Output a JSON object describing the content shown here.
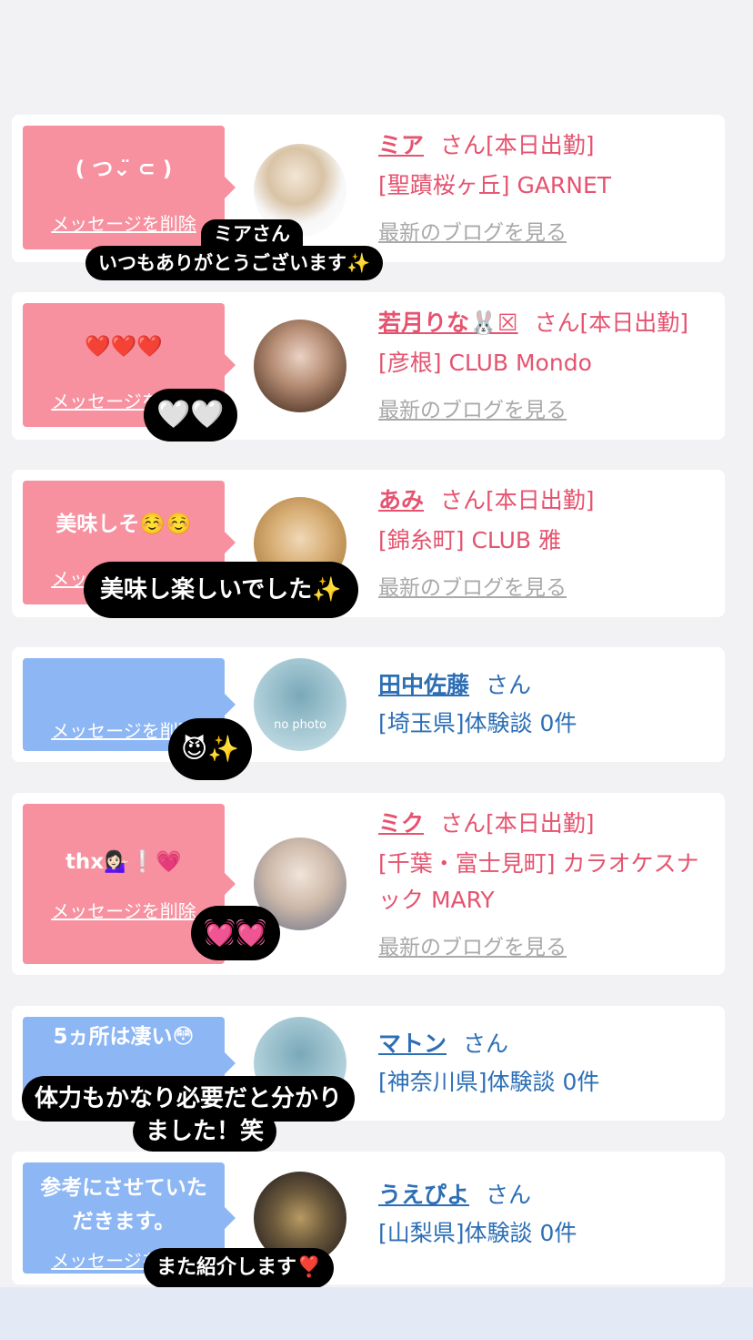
{
  "delete_label": "メッセージを削除",
  "blog_label": "最新のブログを見る",
  "cards": [
    {
      "message": "( つ⌄̈ ⊂ )",
      "name": "ミア",
      "suffix": "さん[本日出勤]",
      "shop": "[聖蹟桜ヶ丘] GARNET",
      "blog": "最新のブログを見る"
    },
    {
      "message": "❤️❤️❤️",
      "name": "若月りな🐰☒",
      "suffix": "さん[本日出勤]",
      "shop": "[彦根] CLUB Mondo",
      "blog": "最新のブログを見る"
    },
    {
      "message": "美味しそ☺️☺️",
      "name": "あみ",
      "suffix": "さん[本日出勤]",
      "shop": "[錦糸町] CLUB 雅",
      "blog": "最新のブログを見る"
    },
    {
      "message": "",
      "name": "田中佐藤",
      "suffix": "さん",
      "shop": "[埼玉県]体験談 0件",
      "avatar_text": "no photo"
    },
    {
      "message": "thx💁🏻‍♀️❕💗",
      "name": "ミク",
      "suffix": "さん[本日出勤]",
      "shop": "[千葉・富士見町] カラオケスナック MARY",
      "blog": "最新のブログを見る"
    },
    {
      "message": "5ヵ所は凄い😳",
      "name": "マトン",
      "suffix": "さん",
      "shop": "[神奈川県]体験談 0件"
    },
    {
      "message": "参考にさせていただきます。",
      "name": "うえぴよ",
      "suffix": "さん",
      "shop": "[山梨県]体験談 0件"
    }
  ],
  "stories": [
    {
      "line1": "ミアさん",
      "line2": "いつもありがとうございます✨"
    },
    {
      "text": "🤍🤍"
    },
    {
      "text": "美味し楽しいでした✨"
    },
    {
      "text": "😈✨"
    },
    {
      "text": "💓💓"
    },
    {
      "line1": "体力もかなり必要だと分かり",
      "line2": "ました！笑"
    },
    {
      "text": "また紹介します❣️"
    }
  ],
  "colors": {
    "pink_bubble": "#f7909f",
    "blue_bubble": "#8db6f4",
    "pink_text": "#e5536f",
    "blue_text": "#2d6fb5"
  }
}
